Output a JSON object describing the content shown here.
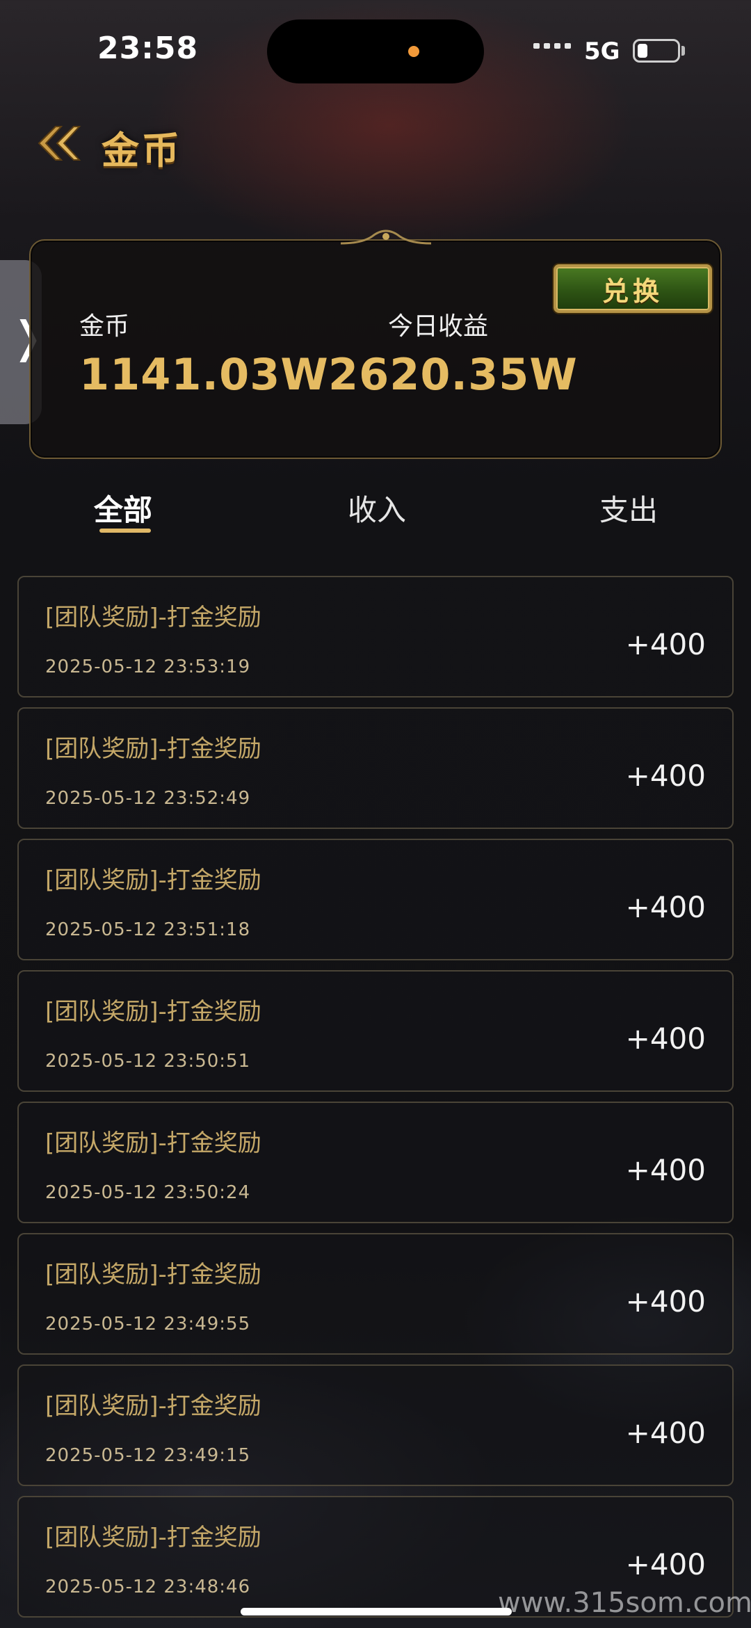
{
  "status_bar": {
    "time": "23:58",
    "network": "5G"
  },
  "header": {
    "title": "金币"
  },
  "card": {
    "exchange_label": "兑换",
    "coins_label": "金币",
    "coins_value": "1141.03W",
    "today_label": "今日收益",
    "today_value": "2620.35W"
  },
  "tabs": [
    {
      "label": "全部"
    },
    {
      "label": "收入"
    },
    {
      "label": "支出"
    }
  ],
  "transactions": [
    {
      "title": "[团队奖励]-打金奖励",
      "time": "2025-05-12 23:53:19",
      "amount": "+400"
    },
    {
      "title": "[团队奖励]-打金奖励",
      "time": "2025-05-12 23:52:49",
      "amount": "+400"
    },
    {
      "title": "[团队奖励]-打金奖励",
      "time": "2025-05-12 23:51:18",
      "amount": "+400"
    },
    {
      "title": "[团队奖励]-打金奖励",
      "time": "2025-05-12 23:50:51",
      "amount": "+400"
    },
    {
      "title": "[团队奖励]-打金奖励",
      "time": "2025-05-12 23:50:24",
      "amount": "+400"
    },
    {
      "title": "[团队奖励]-打金奖励",
      "time": "2025-05-12 23:49:55",
      "amount": "+400"
    },
    {
      "title": "[团队奖励]-打金奖励",
      "time": "2025-05-12 23:49:15",
      "amount": "+400"
    },
    {
      "title": "[团队奖励]-打金奖励",
      "time": "2025-05-12 23:48:46",
      "amount": "+400"
    }
  ],
  "watermark": "www.315som.com"
}
